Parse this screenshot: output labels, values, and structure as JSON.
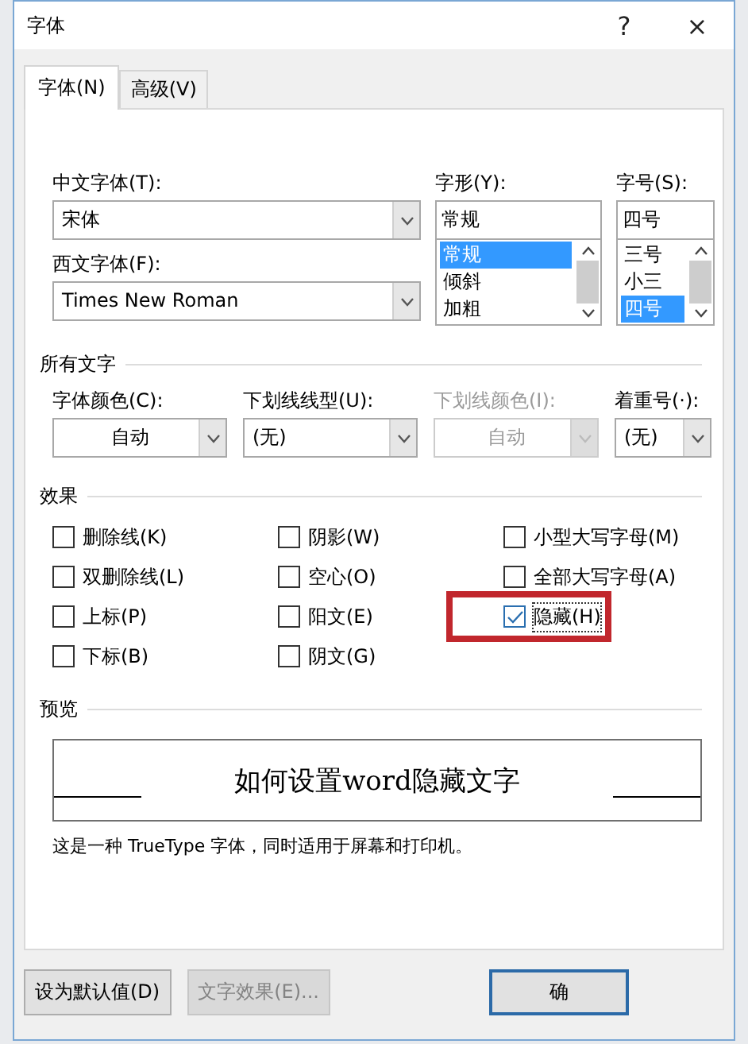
{
  "window": {
    "title": "字体",
    "help": "?",
    "close": "×"
  },
  "tabs": [
    {
      "label": "字体(N)",
      "selected": true
    },
    {
      "label": "高级(V)",
      "selected": false
    }
  ],
  "font": {
    "chinese_label": "中文字体(T):",
    "chinese_value": "宋体",
    "western_label": "西文字体(F):",
    "western_value": "Times New Roman",
    "style_label": "字形(Y):",
    "style_value": "常规",
    "style_options": [
      {
        "label": "常规",
        "selected": true
      },
      {
        "label": "倾斜",
        "selected": false
      },
      {
        "label": "加粗",
        "selected": false
      }
    ],
    "size_label": "字号(S):",
    "size_value": "四号",
    "size_options": [
      {
        "label": "三号",
        "selected": false
      },
      {
        "label": "小三",
        "selected": false
      },
      {
        "label": "四号",
        "selected": true
      }
    ]
  },
  "all_text": {
    "heading": "所有文字",
    "fields": [
      {
        "label": "字体颜色(C):",
        "value": "自动",
        "centered": true,
        "disabled": false
      },
      {
        "label": "下划线线型(U):",
        "value": "(无)",
        "centered": false,
        "disabled": false
      },
      {
        "label": "下划线颜色(I):",
        "value": "自动",
        "centered": true,
        "disabled": true
      },
      {
        "label": "着重号(·):",
        "value": "(无)",
        "centered": false,
        "disabled": false
      }
    ]
  },
  "effects": {
    "heading": "效果",
    "columns": [
      [
        {
          "label": "删除线(K)",
          "checked": false,
          "highlighted": false
        },
        {
          "label": "双删除线(L)",
          "checked": false,
          "highlighted": false
        },
        {
          "label": "上标(P)",
          "checked": false,
          "highlighted": false
        },
        {
          "label": "下标(B)",
          "checked": false,
          "highlighted": false
        }
      ],
      [
        {
          "label": "阴影(W)",
          "checked": false,
          "highlighted": false
        },
        {
          "label": "空心(O)",
          "checked": false,
          "highlighted": false
        },
        {
          "label": "阳文(E)",
          "checked": false,
          "highlighted": false
        },
        {
          "label": "阴文(G)",
          "checked": false,
          "highlighted": false
        }
      ],
      [
        {
          "label": "小型大写字母(M)",
          "checked": false,
          "highlighted": false
        },
        {
          "label": "全部大写字母(A)",
          "checked": false,
          "highlighted": false
        },
        {
          "label": "隐藏(H)",
          "checked": true,
          "highlighted": true
        }
      ]
    ]
  },
  "preview": {
    "heading": "预览",
    "sample": "如何设置word隐藏文字",
    "description": "这是一种 TrueType 字体，同时适用于屏幕和打印机。"
  },
  "buttons": [
    {
      "label": "设为默认值(D)",
      "disabled": false,
      "default": false
    },
    {
      "label": "文字效果(E)...",
      "disabled": true,
      "default": false
    },
    {
      "label": "确",
      "disabled": false,
      "default": true
    }
  ]
}
